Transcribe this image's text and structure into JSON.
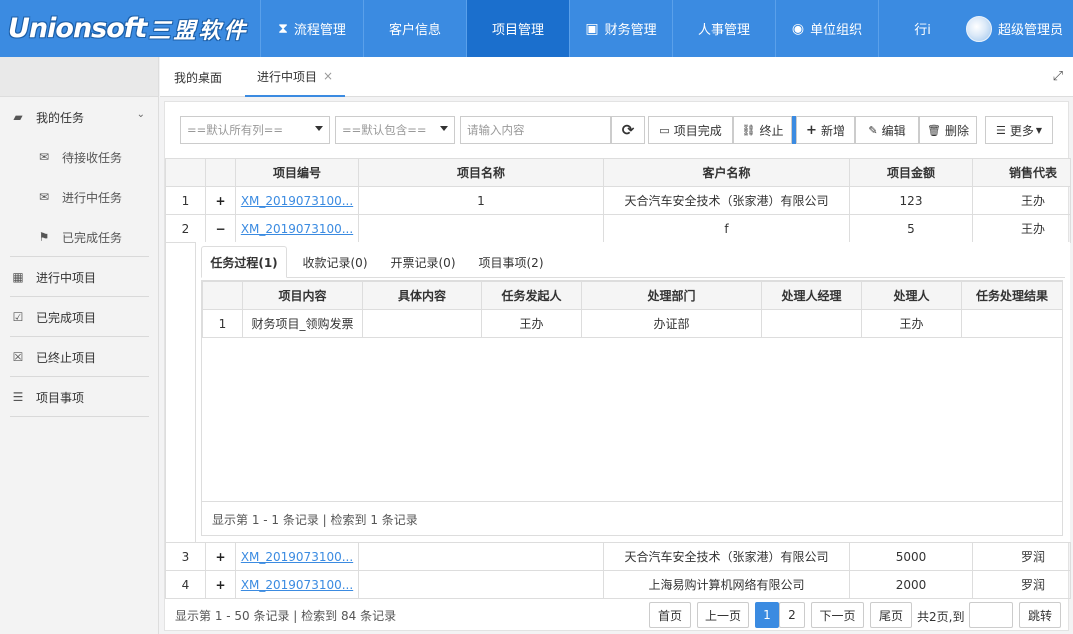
{
  "app": {
    "logo_text": "Unionsoft",
    "logo_cn": "三盟软件"
  },
  "nav": {
    "items": [
      {
        "label": "流程管理",
        "icon": "hourglass-icon"
      },
      {
        "label": "客户信息",
        "icon": ""
      },
      {
        "label": "项目管理",
        "icon": "",
        "active": true
      },
      {
        "label": "财务管理",
        "icon": "money-icon"
      },
      {
        "label": "人事管理",
        "icon": ""
      },
      {
        "label": "单位组织",
        "icon": "user-circle-icon"
      },
      {
        "label": "行i",
        "icon": ""
      }
    ],
    "user": "超级管理员"
  },
  "sidebar": {
    "items": [
      {
        "label": "我的任务",
        "icon": "folder-open-icon"
      },
      {
        "label": "待接收任务",
        "icon": "envelope-icon"
      },
      {
        "label": "进行中任务",
        "icon": "envelope-open-icon"
      },
      {
        "label": "已完成任务",
        "icon": "flag-icon"
      },
      {
        "label": "进行中项目",
        "icon": "calendar-icon"
      },
      {
        "label": "已完成项目",
        "icon": "calendar-check-icon"
      },
      {
        "label": "已终止项目",
        "icon": "calendar-times-icon"
      },
      {
        "label": "项目事项",
        "icon": "list-icon"
      }
    ]
  },
  "tabs": [
    {
      "label": "我的桌面"
    },
    {
      "label": "进行中项目",
      "close": "×"
    }
  ],
  "toolbar": {
    "column_select": "==默认所有列==",
    "match_select": "==默认包含==",
    "search_placeholder": "请输入内容",
    "refresh_icon": "⟳",
    "complete_label": "项目完成",
    "terminate_label": "终止",
    "add_label": "新增",
    "edit_label": "编辑",
    "delete_label": "删除",
    "more_label": "更多"
  },
  "table": {
    "headers": [
      "",
      "",
      "项目编号",
      "项目名称",
      "客户名称",
      "项目金额",
      "销售代表"
    ],
    "rows": [
      {
        "idx": "1",
        "toggle": "+",
        "code": "XM_2019073100...",
        "name": "1",
        "customer": "天合汽车安全技术（张家港）有限公司",
        "amount": "123",
        "sales": "王办"
      },
      {
        "idx": "2",
        "toggle": "−",
        "code": "XM_2019073100...",
        "name": "",
        "customer": "f",
        "amount": "5",
        "sales": "王办"
      },
      {
        "idx": "3",
        "toggle": "+",
        "code": "XM_2019073100...",
        "name": "",
        "customer": "天合汽车安全技术（张家港）有限公司",
        "amount": "5000",
        "sales": "罗润"
      },
      {
        "idx": "4",
        "toggle": "+",
        "code": "XM_2019073100...",
        "name": "",
        "customer": "上海易购计算机网络有限公司",
        "amount": "2000",
        "sales": "罗润"
      }
    ]
  },
  "detail": {
    "tabs": [
      "任务过程(1)",
      "收款记录(0)",
      "开票记录(0)",
      "项目事项(2)"
    ],
    "headers": [
      "",
      "项目内容",
      "具体内容",
      "任务发起人",
      "处理部门",
      "处理人经理",
      "处理人",
      "任务处理结果"
    ],
    "rows": [
      {
        "idx": "1",
        "content": "财务项目_领购发票",
        "detail": "",
        "initiator": "王办",
        "dept": "办证部",
        "manager": "",
        "handler": "王办",
        "result": ""
      }
    ],
    "footer": "显示第 1 - 1 条记录 | 检索到 1 条记录"
  },
  "pagination": {
    "info": "显示第 1 - 50 条记录 | 检索到 84 条记录",
    "first": "首页",
    "prev": "上一页",
    "pages": [
      "1",
      "2"
    ],
    "next": "下一页",
    "last": "尾页",
    "total_text": "共2页,到",
    "go": "跳转"
  }
}
